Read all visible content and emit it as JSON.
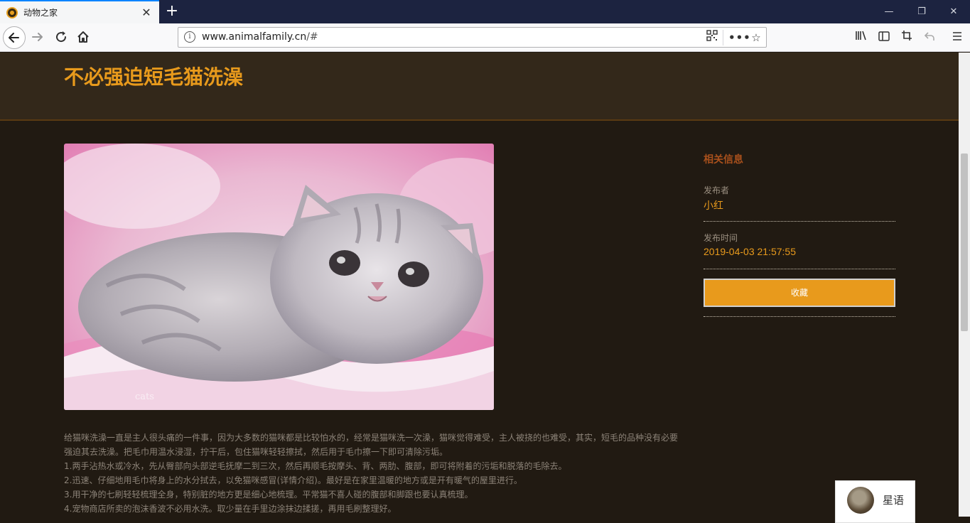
{
  "browser": {
    "tab_title": "动物之家",
    "tab_close": "✕",
    "new_tab": "+",
    "url_host": "www.animalfamily.cn",
    "url_path": "/#",
    "info_icon": "i",
    "icons": [
      "back-icon",
      "forward-icon",
      "reload-icon",
      "home-icon",
      "qr-code-icon",
      "more-icon",
      "bookmark-star-icon",
      "library-icon",
      "sidebar-icon",
      "screenshot-icon",
      "undo-icon",
      "menu-icon"
    ]
  },
  "page": {
    "title": "不必强迫短毛猫洗澡"
  },
  "sidebar": {
    "heading": "相关信息",
    "publisher_label": "发布者",
    "publisher_value": "小红",
    "time_label": "发布时间",
    "time_value": "2019-04-03 21:57:55",
    "favorite_button": "收藏"
  },
  "article": {
    "paragraphs": [
      "给猫咪洗澡一直是主人很头痛的一件事，因为大多数的猫咪都是比较怕水的，经常是猫咪洗一次澡，猫咪觉得难受，主人被挠的也难受，其实，短毛的品种没有必要强迫其去洗澡。把毛巾用温水浸湿，拧干后，包住猫咪轻轻擦拭，然后用于毛巾擦一下即可清除污垢。",
      "1.两手沾热水或冷水，先从臀部向头部逆毛抚摩二到三次，然后再顺毛按摩头、背、两肋、腹部，即可将附着的污垢和脱落的毛除去。",
      "2.迅速、仔细地用毛巾将身上的水分拭去，以免猫咪感冒(详情介绍)。最好是在家里温暖的地方或是开有暖气的屋里进行。",
      "3.用干净的七刷轻轻梳理全身，特别脏的地方更是细心地梳理。平常猫不喜人碰的腹部和脚跟也要认真梳理。",
      "4.宠物商店所卖的泡沫香波不必用水洗。取少量在手里边涂抹边揉搓，再用毛刷整理好。"
    ]
  },
  "chat_widget": {
    "label": "星语"
  },
  "colors": {
    "accent": "#e89a1c",
    "header_bg": "#33281a",
    "page_bg": "#211a12",
    "heading_rust": "#a8501c"
  }
}
